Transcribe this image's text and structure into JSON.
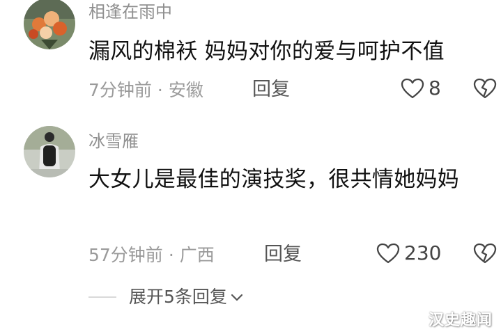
{
  "comments": [
    {
      "username": "相逢在雨中",
      "text": "漏风的棉袄 妈妈对你的爱与呵护不值",
      "time": "7分钟前",
      "location": "安徽",
      "reply_label": "回复",
      "like_count": "8",
      "avatar_icon": "flower-bouquet-avatar"
    },
    {
      "username": "冰雪雁",
      "text": "大女儿是最佳的演技奖，很共情她妈妈",
      "time": "57分钟前",
      "location": "广西",
      "reply_label": "回复",
      "like_count": "230",
      "avatar_icon": "person-backpack-avatar"
    }
  ],
  "separator": "·",
  "expand_label": "展开5条回复",
  "watermark": "汉史趣闻",
  "colors": {
    "text": "#111111",
    "meta": "#9a9a9a",
    "username": "#8f8f8f"
  }
}
